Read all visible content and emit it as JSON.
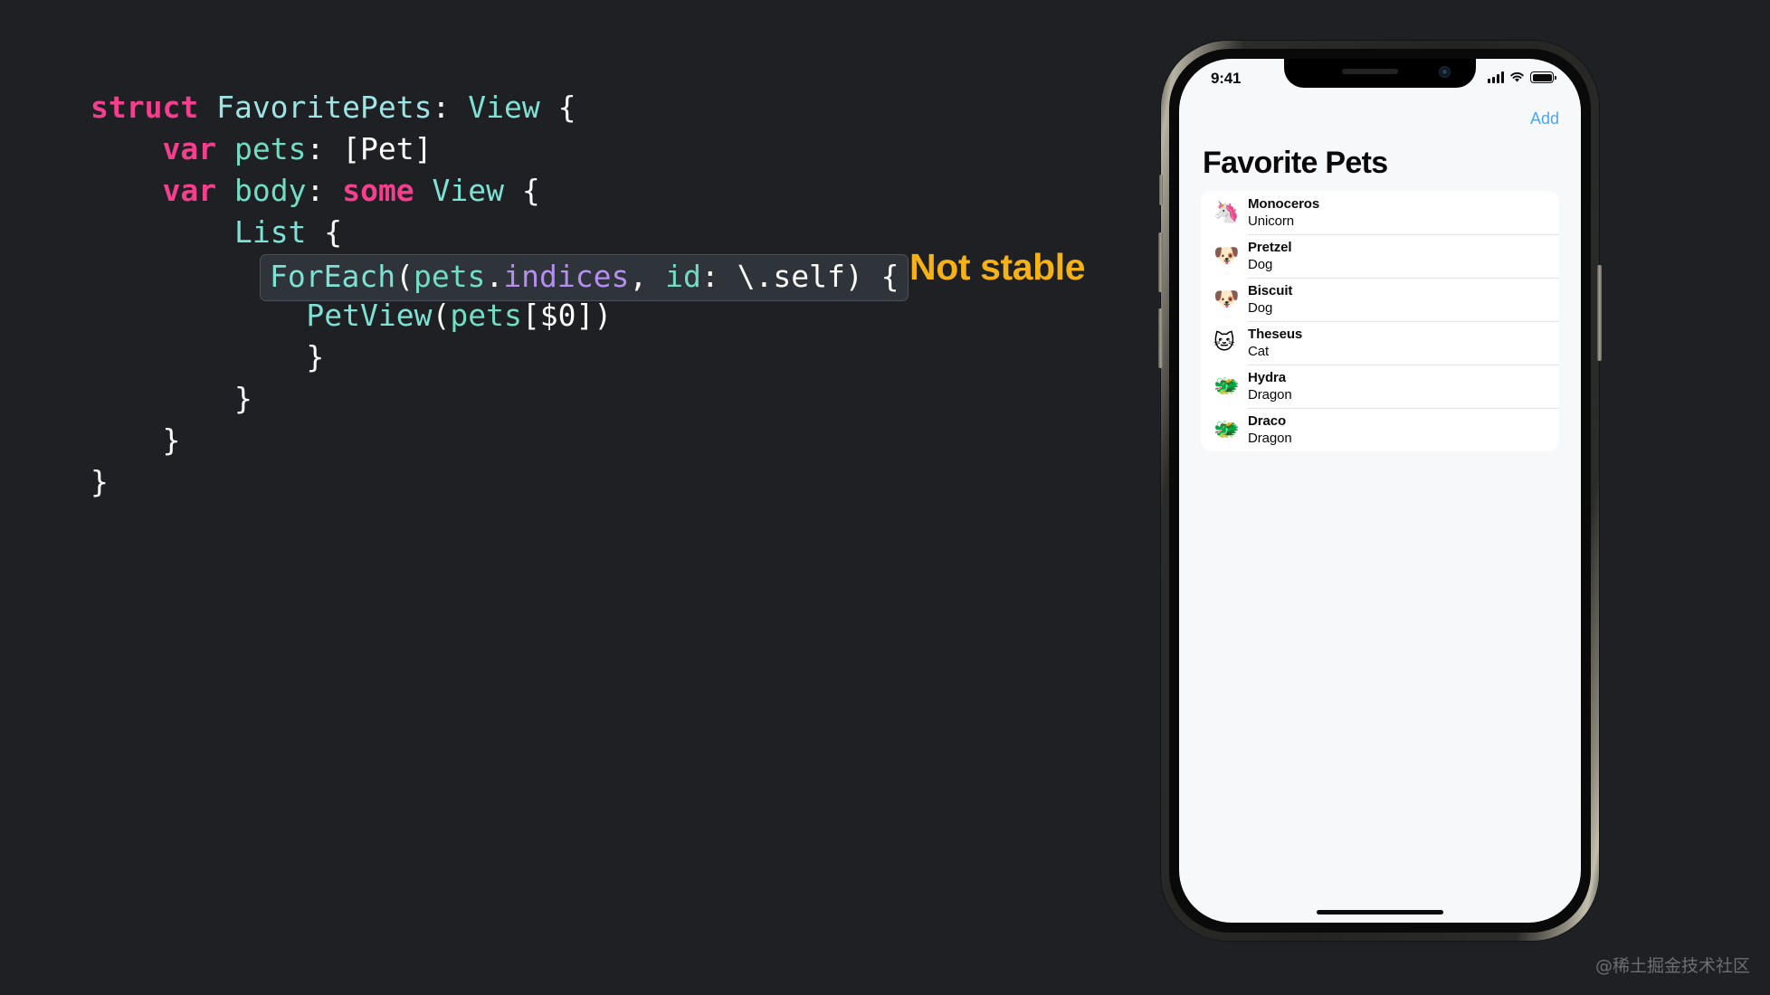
{
  "background_color": "#1e2023",
  "code": {
    "language": "swift",
    "lines": [
      [
        {
          "t": "struct ",
          "c": "kw"
        },
        {
          "t": "FavoritePets",
          "c": "type"
        },
        {
          "t": ": ",
          "c": "plain"
        },
        {
          "t": "View",
          "c": "typec"
        },
        {
          "t": " {",
          "c": "plain"
        }
      ],
      [
        {
          "t": "    ",
          "c": "plain"
        },
        {
          "t": "var ",
          "c": "kw"
        },
        {
          "t": "pets",
          "c": "ident"
        },
        {
          "t": ": [Pet]",
          "c": "plain"
        }
      ],
      [
        {
          "t": "    ",
          "c": "plain"
        },
        {
          "t": "var ",
          "c": "kw"
        },
        {
          "t": "body",
          "c": "ident"
        },
        {
          "t": ": ",
          "c": "plain"
        },
        {
          "t": "some ",
          "c": "kw"
        },
        {
          "t": "View",
          "c": "typec"
        },
        {
          "t": " {",
          "c": "plain"
        }
      ],
      [
        {
          "t": "        ",
          "c": "plain"
        },
        {
          "t": "List",
          "c": "typec"
        },
        {
          "t": " {",
          "c": "plain"
        }
      ],
      [
        {
          "t": "",
          "c": "plain"
        }
      ],
      [
        {
          "t": "            ",
          "c": "plain"
        },
        {
          "t": "PetView",
          "c": "typec"
        },
        {
          "t": "(",
          "c": "plain"
        },
        {
          "t": "pets",
          "c": "ident"
        },
        {
          "t": "[$0])",
          "c": "plain"
        }
      ],
      [
        {
          "t": "            }",
          "c": "plain"
        }
      ],
      [
        {
          "t": "        }",
          "c": "plain"
        }
      ],
      [
        {
          "t": "    }",
          "c": "plain"
        }
      ],
      [
        {
          "t": "}",
          "c": "plain"
        }
      ]
    ],
    "highlighted_line": [
      {
        "t": "ForEach",
        "c": "typec"
      },
      {
        "t": "(",
        "c": "plain"
      },
      {
        "t": "pets",
        "c": "ident"
      },
      {
        "t": ".",
        "c": "plain"
      },
      {
        "t": "indices",
        "c": "prop"
      },
      {
        "t": ", ",
        "c": "plain"
      },
      {
        "t": "id",
        "c": "ident"
      },
      {
        "t": ": \\.self) {",
        "c": "plain"
      }
    ],
    "highlighted_line_text": "ForEach(pets.indices, id: \\.self) {",
    "colors": {
      "keyword": "#f43f8e",
      "type": "#7fe0d4",
      "identifier": "#72ddc4",
      "property": "#b48ff0",
      "plain": "#ffffff",
      "highlight_bg": "#2f333a",
      "highlight_border": "#4c5159"
    }
  },
  "annotation": {
    "label": "Not stable",
    "color": "#f5b118",
    "connector_color": "#e8e8e8"
  },
  "phone": {
    "status_bar": {
      "time": "9:41",
      "signal_icon": "cellular-signal-icon",
      "wifi_icon": "wifi-icon",
      "battery_icon": "battery-icon"
    },
    "nav_bar": {
      "add_label": "Add",
      "add_color": "#4ca6ef"
    },
    "title": "Favorite Pets",
    "pets": [
      {
        "emoji": "🦄",
        "emoji_name": "unicorn-emoji",
        "name": "Monoceros",
        "kind": "Unicorn"
      },
      {
        "emoji": "🐶",
        "emoji_name": "dog-face-emoji",
        "name": "Pretzel",
        "kind": "Dog"
      },
      {
        "emoji": "🐶",
        "emoji_name": "dog-face-emoji",
        "name": "Biscuit",
        "kind": "Dog"
      },
      {
        "emoji": "🐱",
        "emoji_name": "cat-face-emoji",
        "name": "Theseus",
        "kind": "Cat"
      },
      {
        "emoji": "🐲",
        "emoji_name": "dragon-face-emoji",
        "name": "Hydra",
        "kind": "Dragon"
      },
      {
        "emoji": "🐲",
        "emoji_name": "dragon-face-emoji",
        "name": "Draco",
        "kind": "Dragon"
      }
    ]
  },
  "watermark": "@稀土掘金技术社区"
}
